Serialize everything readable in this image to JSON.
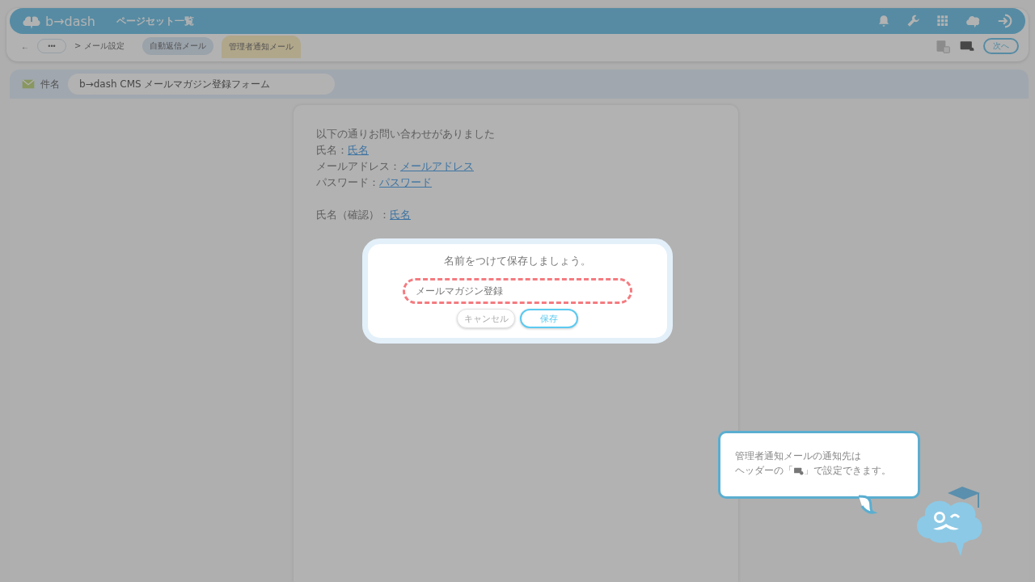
{
  "header": {
    "logo": "b→dash",
    "title": "ページセット一覧"
  },
  "toolbar": {
    "back": "←",
    "more": "•••",
    "breadcrumb": "> メール設定",
    "tabs": [
      {
        "label": "自動返信メール",
        "selected": false
      },
      {
        "label": "管理者通知メール",
        "selected": true
      }
    ],
    "next_button": "次へ"
  },
  "subject": {
    "label": "件名",
    "value": "b→dash CMS メールマガジン登録フォーム"
  },
  "mail_body": {
    "intro": "以下の通りお問い合わせがありました",
    "fields": [
      {
        "label": "氏名：",
        "link": "氏名"
      },
      {
        "label": "メールアドレス：",
        "link": "メールアドレス"
      },
      {
        "label": "パスワード：",
        "link": "パスワード"
      }
    ],
    "confirm_fields": [
      {
        "label": "氏名（確認）：",
        "link": "氏名"
      }
    ]
  },
  "dialog": {
    "title": "名前をつけて保存しましょう。",
    "value": "メールマガジン登録",
    "cancel": "キャンセル",
    "save": "保存"
  },
  "tip": {
    "line1": "管理者通知メールの通知先は",
    "line2_before": "ヘッダーの「",
    "line2_after": "」で設定できます。"
  }
}
